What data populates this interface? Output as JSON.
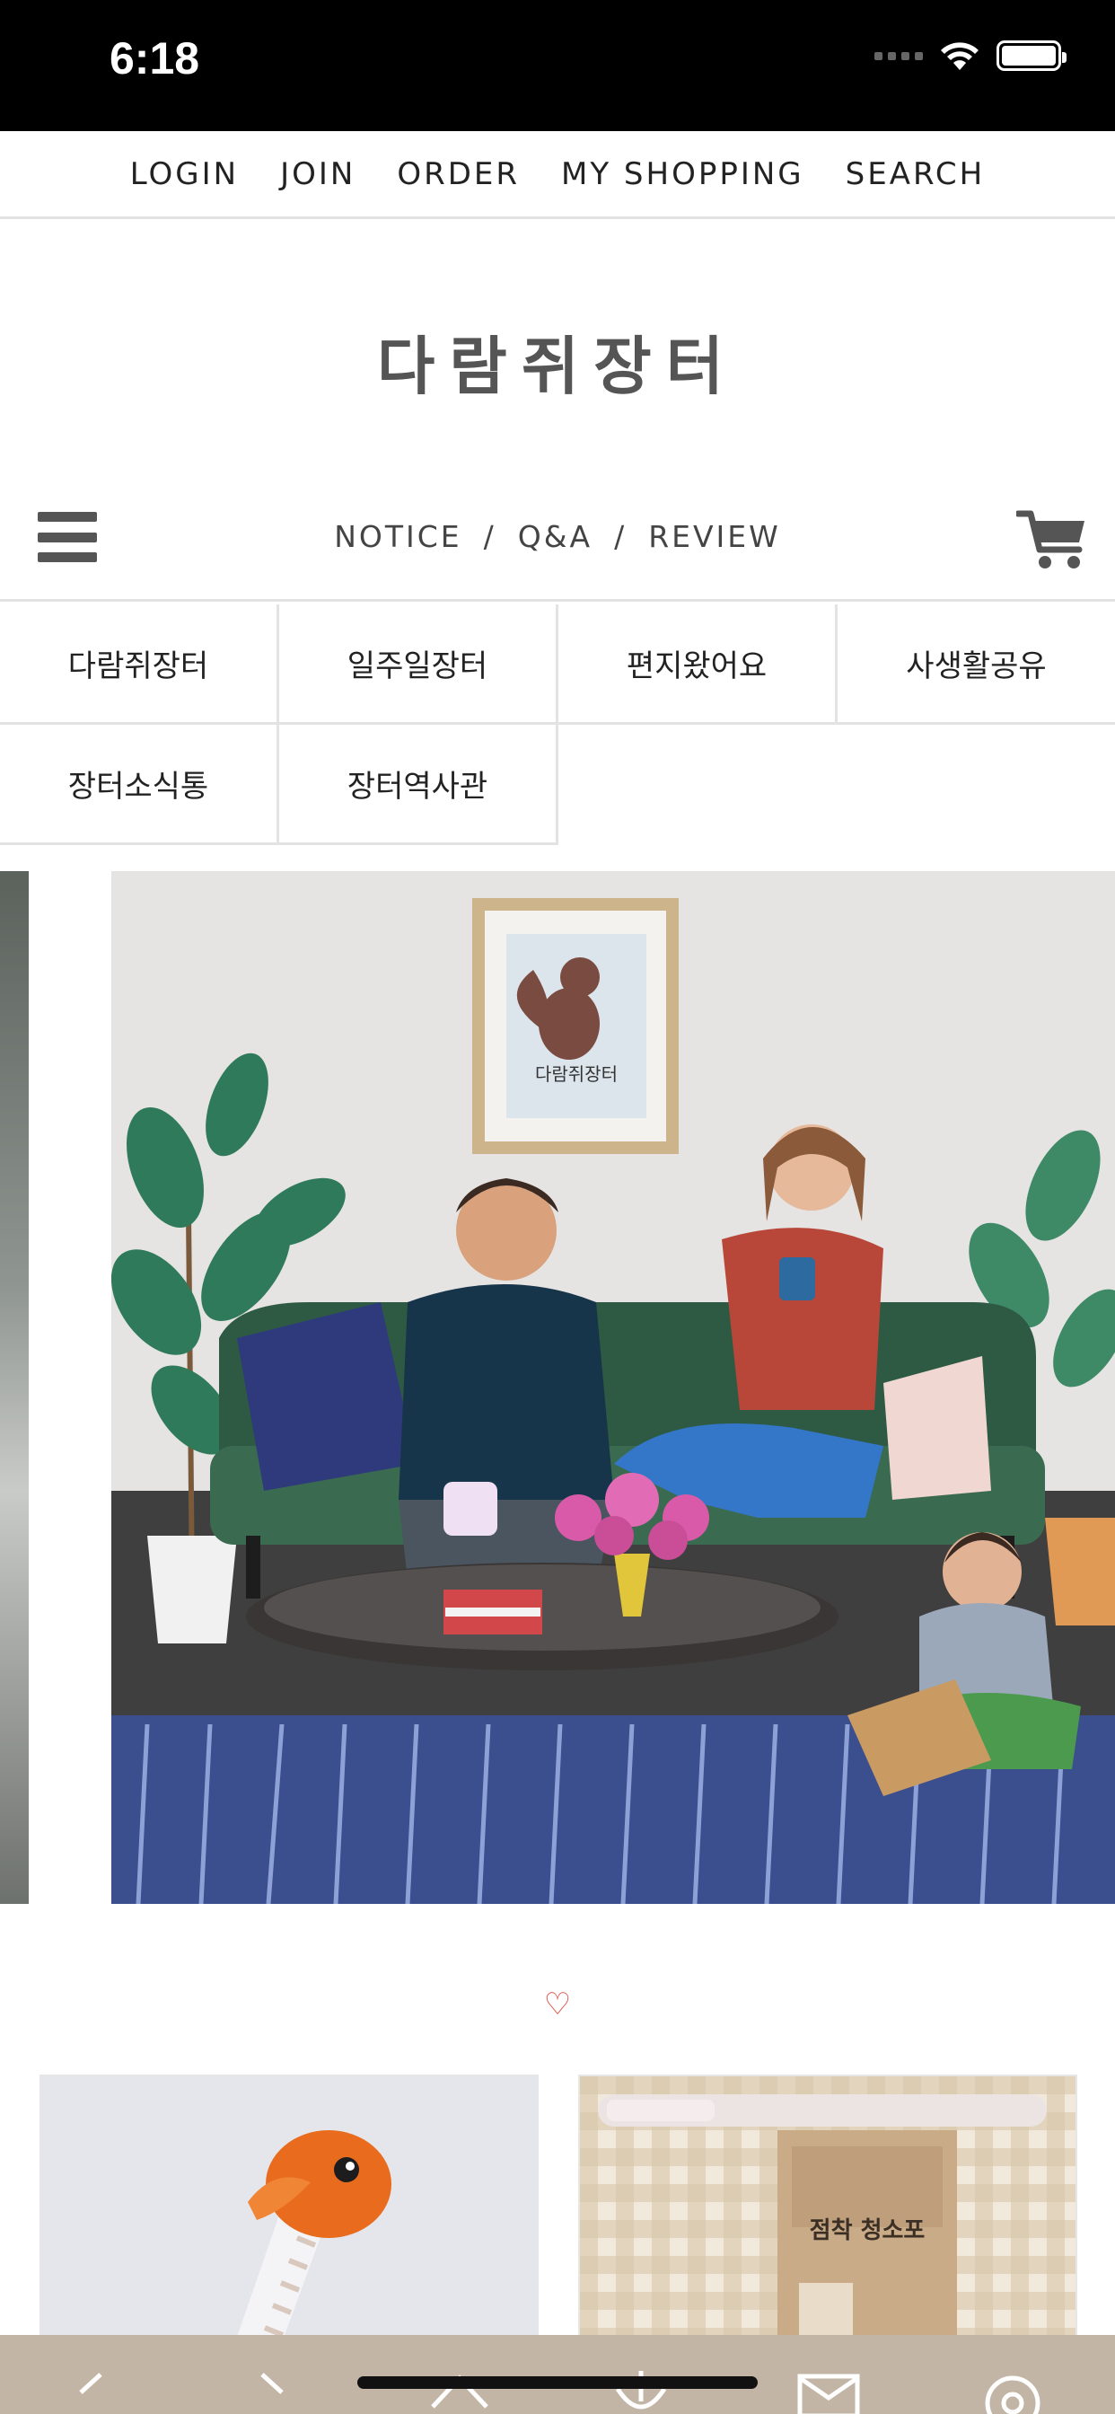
{
  "status_bar": {
    "time": "6:18"
  },
  "top_nav": [
    "LOGIN",
    "JOIN",
    "ORDER",
    "MY SHOPPING",
    "SEARCH"
  ],
  "logo": "다람쥐장터",
  "boards": {
    "notice": "NOTICE",
    "qa": "Q&A",
    "review": "REVIEW",
    "separator": "/"
  },
  "menu": [
    "다람쥐장터",
    "일주일장터",
    "편지왔어요",
    "사생활공유",
    "장터소식통",
    "장터역사관"
  ],
  "banner": {
    "frame_text": "다람쥐장터"
  },
  "section_heart": "♡",
  "products": [
    {
      "image": "orange-bird-pen"
    },
    {
      "image": "cleaning-cloth-package",
      "label": "점착 청소포"
    }
  ],
  "toolbar": {
    "icons": [
      "back-arrow-icon",
      "forward-arrow-icon",
      "home-icon",
      "download-icon",
      "mail-icon",
      "settings-icon"
    ]
  },
  "colors": {
    "toolbar_bg": "#c2b5a6",
    "heart": "#e0453f",
    "divider": "#e3e3e3"
  }
}
